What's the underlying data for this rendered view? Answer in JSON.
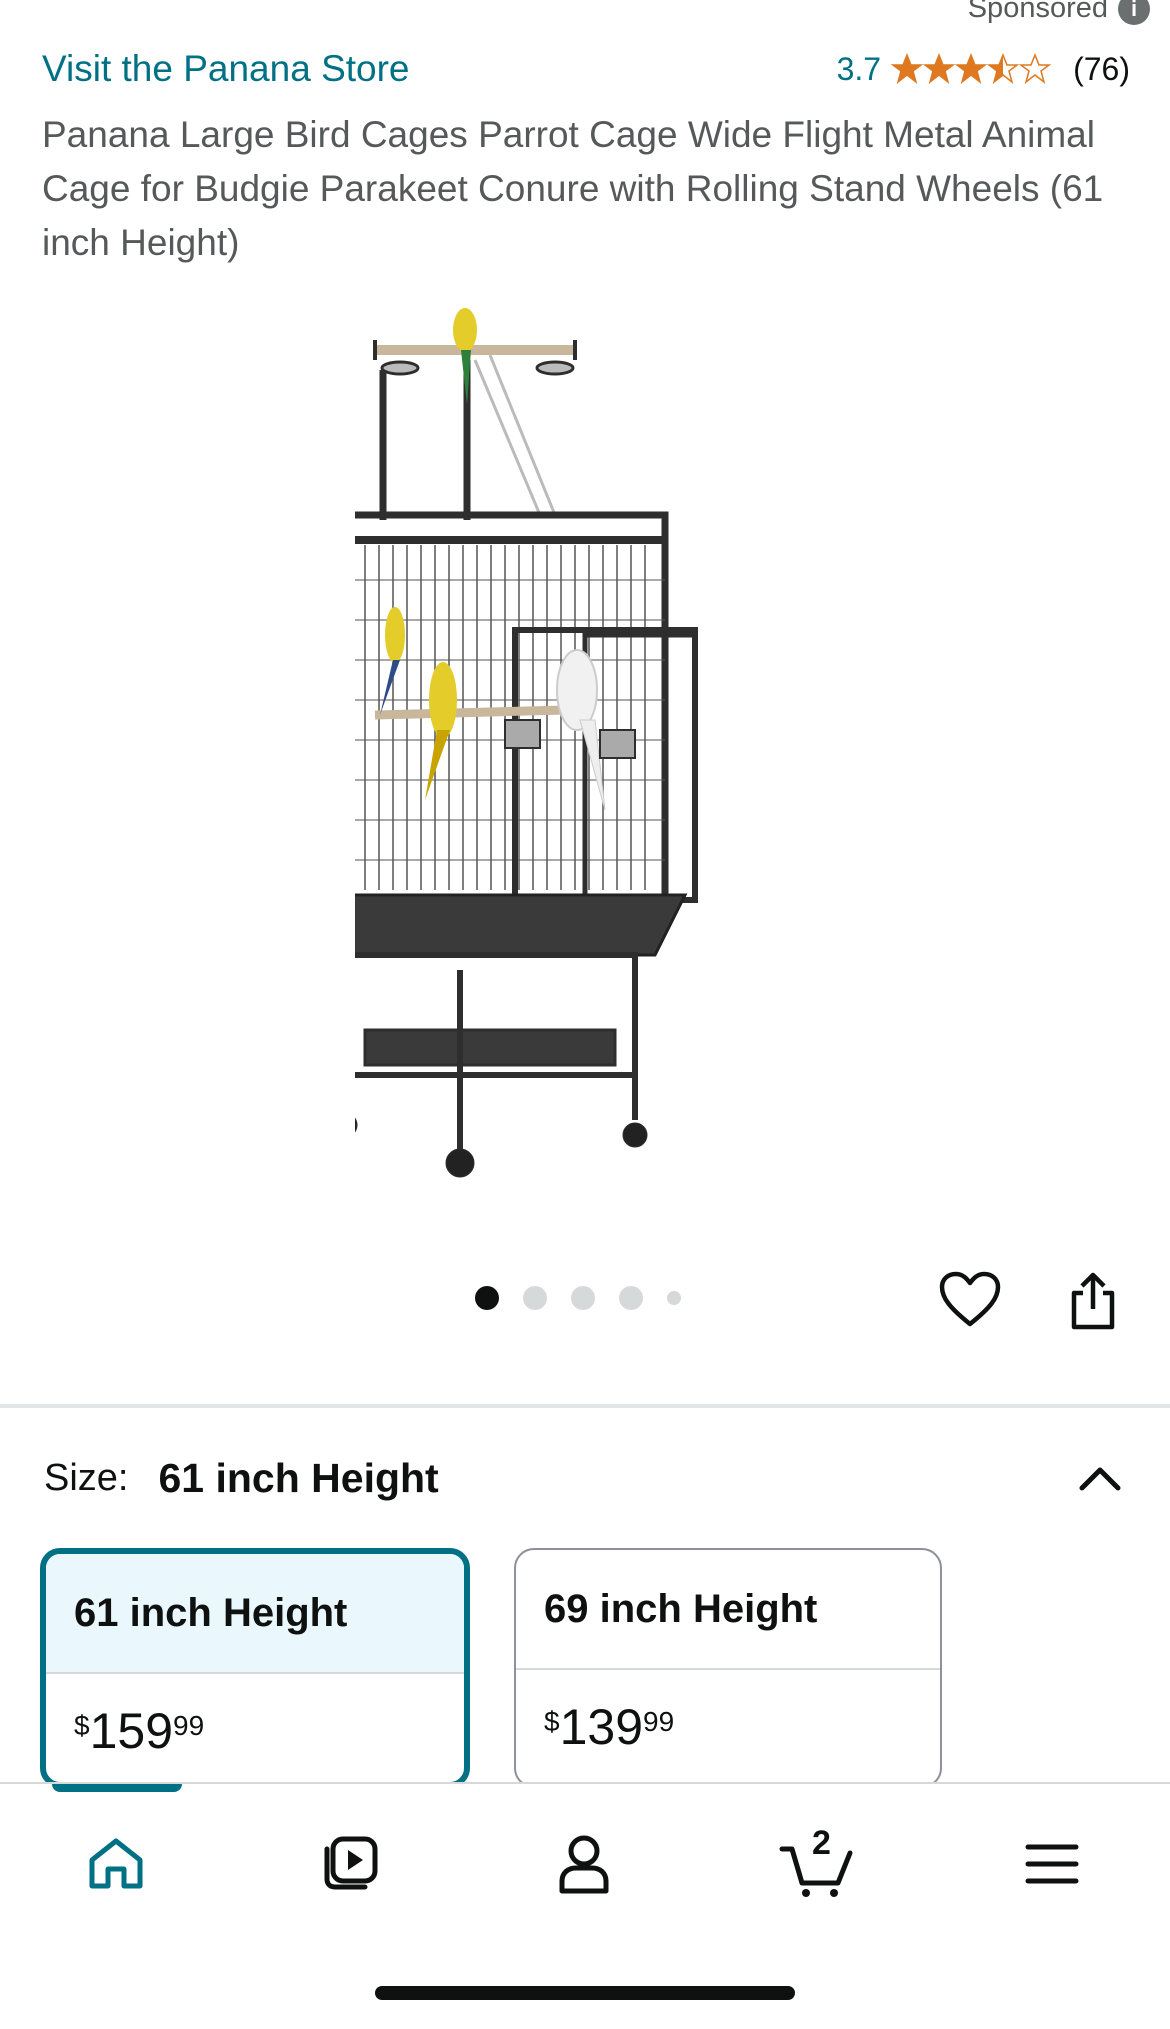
{
  "header": {
    "sponsored_label": "Sponsored",
    "store_link": "Visit the Panana Store",
    "rating_value": "3.7",
    "rating_stars": 3.7,
    "rating_count": "(76)",
    "product_title": "Panana Large Bird Cages Parrot Cage Wide Flight Metal Animal Cage for Budgie Parakeet Conure with Rolling Stand Wheels (61 inch Height)"
  },
  "gallery": {
    "image_count": 5,
    "active_index": 0
  },
  "size": {
    "label": "Size:",
    "selected_value": "61 inch Height",
    "options": [
      {
        "name": "61 inch Height",
        "currency": "$",
        "whole": "159",
        "fraction": "99",
        "selected": true
      },
      {
        "name": "69 inch Height",
        "currency": "$",
        "whole": "139",
        "fraction": "99",
        "selected": false
      }
    ]
  },
  "bottom_nav": {
    "items": [
      "home-icon",
      "video-icon",
      "account-icon",
      "cart-icon",
      "menu-icon"
    ],
    "cart_count": "2",
    "active": "home-icon"
  },
  "colors": {
    "link": "#007185",
    "star": "#de7921",
    "selected_border": "#007185",
    "selected_bg": "#eaf8fd",
    "text": "#0f1111"
  }
}
